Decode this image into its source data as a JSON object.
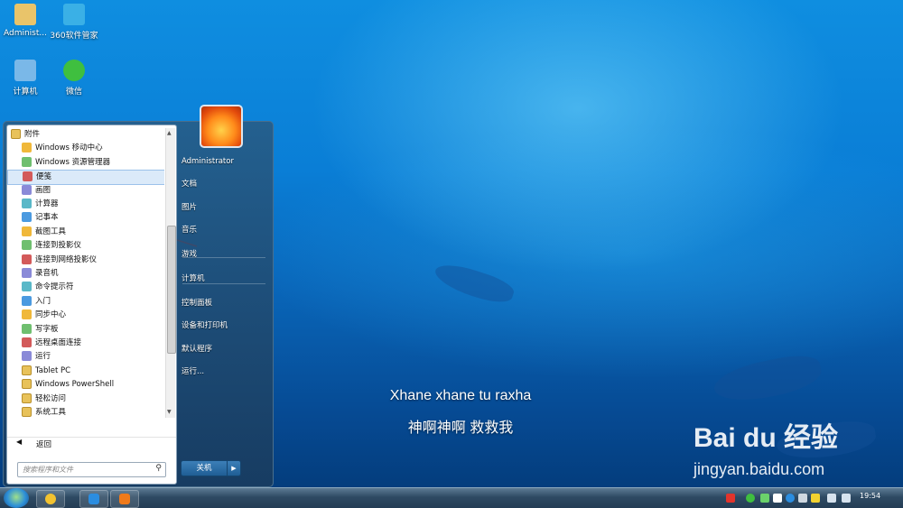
{
  "desktop": {
    "icons": [
      {
        "label": "Administ...",
        "name": "administrator-folder-icon",
        "color": "#e9c46a"
      },
      {
        "label": "360软件管家",
        "name": "360-software-manager-icon",
        "color": "#3ab0e6"
      },
      {
        "label": "计算机",
        "name": "computer-icon",
        "color": "#7ab8e8"
      },
      {
        "label": "微信",
        "name": "wechat-icon",
        "color": "#3fbf3f"
      }
    ],
    "subtitle_line1": "Xhane xhane tu raxha",
    "subtitle_line2": "神啊神啊 救救我",
    "watermark_brand": "Bai du 经验",
    "watermark_url": "jingyan.baidu.com"
  },
  "start_menu": {
    "programs": [
      {
        "label": "附件",
        "type": "folder"
      },
      {
        "label": "Windows 移动中心",
        "type": "app"
      },
      {
        "label": "Windows 资源管理器",
        "type": "app"
      },
      {
        "label": "便笺",
        "type": "app"
      },
      {
        "label": "画图",
        "type": "app"
      },
      {
        "label": "计算器",
        "type": "app"
      },
      {
        "label": "记事本",
        "type": "app"
      },
      {
        "label": "截图工具",
        "type": "app"
      },
      {
        "label": "连接到投影仪",
        "type": "app"
      },
      {
        "label": "连接到网络投影仪",
        "type": "app"
      },
      {
        "label": "录音机",
        "type": "app"
      },
      {
        "label": "命令提示符",
        "type": "app"
      },
      {
        "label": "入门",
        "type": "app"
      },
      {
        "label": "同步中心",
        "type": "app"
      },
      {
        "label": "写字板",
        "type": "app"
      },
      {
        "label": "远程桌面连接",
        "type": "app"
      },
      {
        "label": "运行",
        "type": "app"
      },
      {
        "label": "Tablet PC",
        "type": "folder"
      },
      {
        "label": "Windows PowerShell",
        "type": "folder"
      },
      {
        "label": "轻松访问",
        "type": "folder"
      },
      {
        "label": "系统工具",
        "type": "folder"
      }
    ],
    "highlighted_index": 3,
    "back_label": "返回",
    "search_placeholder": "搜索程序和文件",
    "right_items": [
      "Administrator",
      "文档",
      "图片",
      "音乐",
      "游戏",
      "计算机",
      "控制面板",
      "设备和打印机",
      "默认程序",
      "运行..."
    ],
    "shutdown_label": "关机"
  },
  "taskbar": {
    "clock": "19:54"
  },
  "colors": {
    "arrow": "#e02020",
    "highlight": "#dbeaf9"
  }
}
